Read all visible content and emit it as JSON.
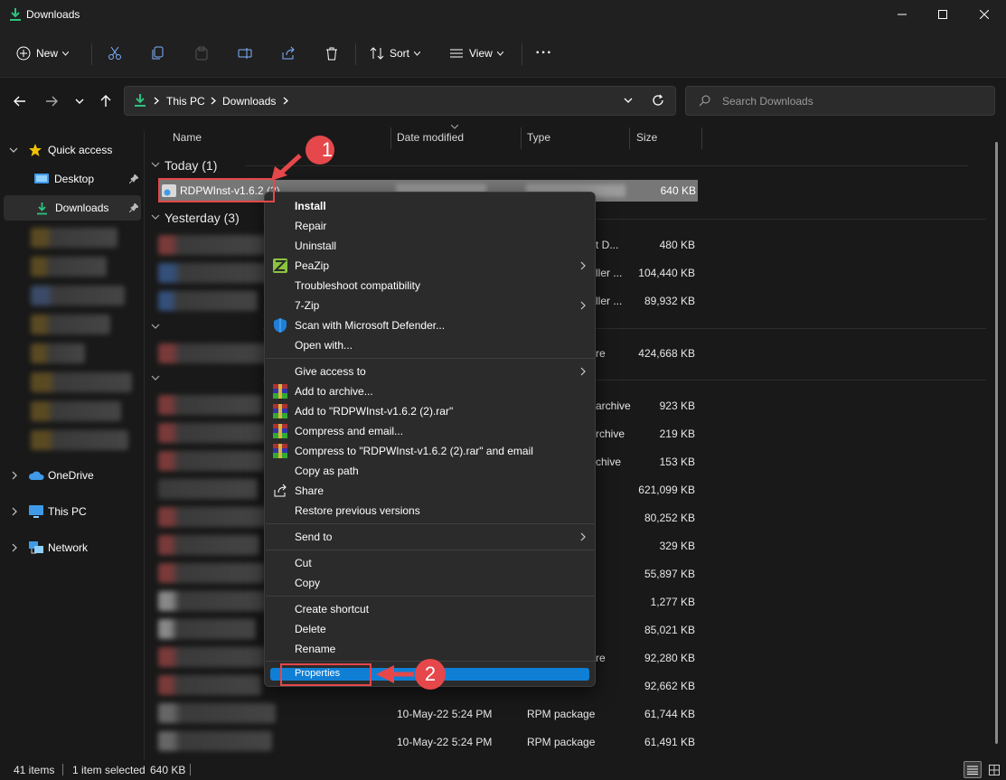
{
  "window": {
    "title": "Downloads",
    "accent": "#0f7fd6"
  },
  "toolbar": {
    "new_label": "New",
    "sort_label": "Sort",
    "view_label": "View",
    "more_label": "···"
  },
  "address": {
    "crumbs": [
      "This PC",
      "Downloads"
    ],
    "search_placeholder": "Search Downloads"
  },
  "sidebar": {
    "quick_access": "Quick access",
    "desktop": "Desktop",
    "downloads": "Downloads",
    "onedrive": "OneDrive",
    "this_pc": "This PC",
    "network": "Network"
  },
  "columns": {
    "name": "Name",
    "date": "Date modified",
    "type": "Type",
    "size": "Size"
  },
  "groups": {
    "today": "Today (1)",
    "yesterday": "Yesterday (3)"
  },
  "selected_file": {
    "name": "RDPWInst-v1.6.2 (2)",
    "size": "640 KB"
  },
  "partial_types": [
    "t D...",
    "ller ...",
    "ller ...",
    "re",
    "archive",
    "rchive",
    "chive",
    "re"
  ],
  "sizes": [
    "480 KB",
    "104,440 KB",
    "89,932 KB",
    "424,668 KB",
    "923 KB",
    "219 KB",
    "153 KB",
    "621,099 KB",
    "80,252 KB",
    "329 KB",
    "55,897 KB",
    "1,277 KB",
    "85,021 KB",
    "92,280 KB",
    "92,662 KB",
    "61,744 KB",
    "61,491 KB"
  ],
  "bottom_rows": [
    {
      "date": "10-May-22 5:24 PM",
      "type": "RPM package",
      "size": "61,744 KB"
    },
    {
      "date": "10-May-22 5:24 PM",
      "type": "RPM package",
      "size": "61,491 KB"
    }
  ],
  "context_menu": {
    "install": "Install",
    "repair": "Repair",
    "uninstall": "Uninstall",
    "peazip": "PeaZip",
    "troubleshoot": "Troubleshoot compatibility",
    "sevenzip": "7-Zip",
    "defender": "Scan with Microsoft Defender...",
    "open_with": "Open with...",
    "give_access": "Give access to",
    "add_archive": "Add to archive...",
    "add_rar": "Add to \"RDPWInst-v1.6.2 (2).rar\"",
    "compress_email": "Compress and email...",
    "compress_rar_email": "Compress to \"RDPWInst-v1.6.2 (2).rar\" and email",
    "copy_path": "Copy as path",
    "share": "Share",
    "restore": "Restore previous versions",
    "send_to": "Send to",
    "cut": "Cut",
    "copy": "Copy",
    "create_shortcut": "Create shortcut",
    "delete": "Delete",
    "rename": "Rename",
    "properties": "Properties"
  },
  "annotations": {
    "step1": "1",
    "step2": "2",
    "color": "#e5474a"
  },
  "status": {
    "items": "41 items",
    "selected": "1 item selected",
    "size": "640 KB"
  }
}
